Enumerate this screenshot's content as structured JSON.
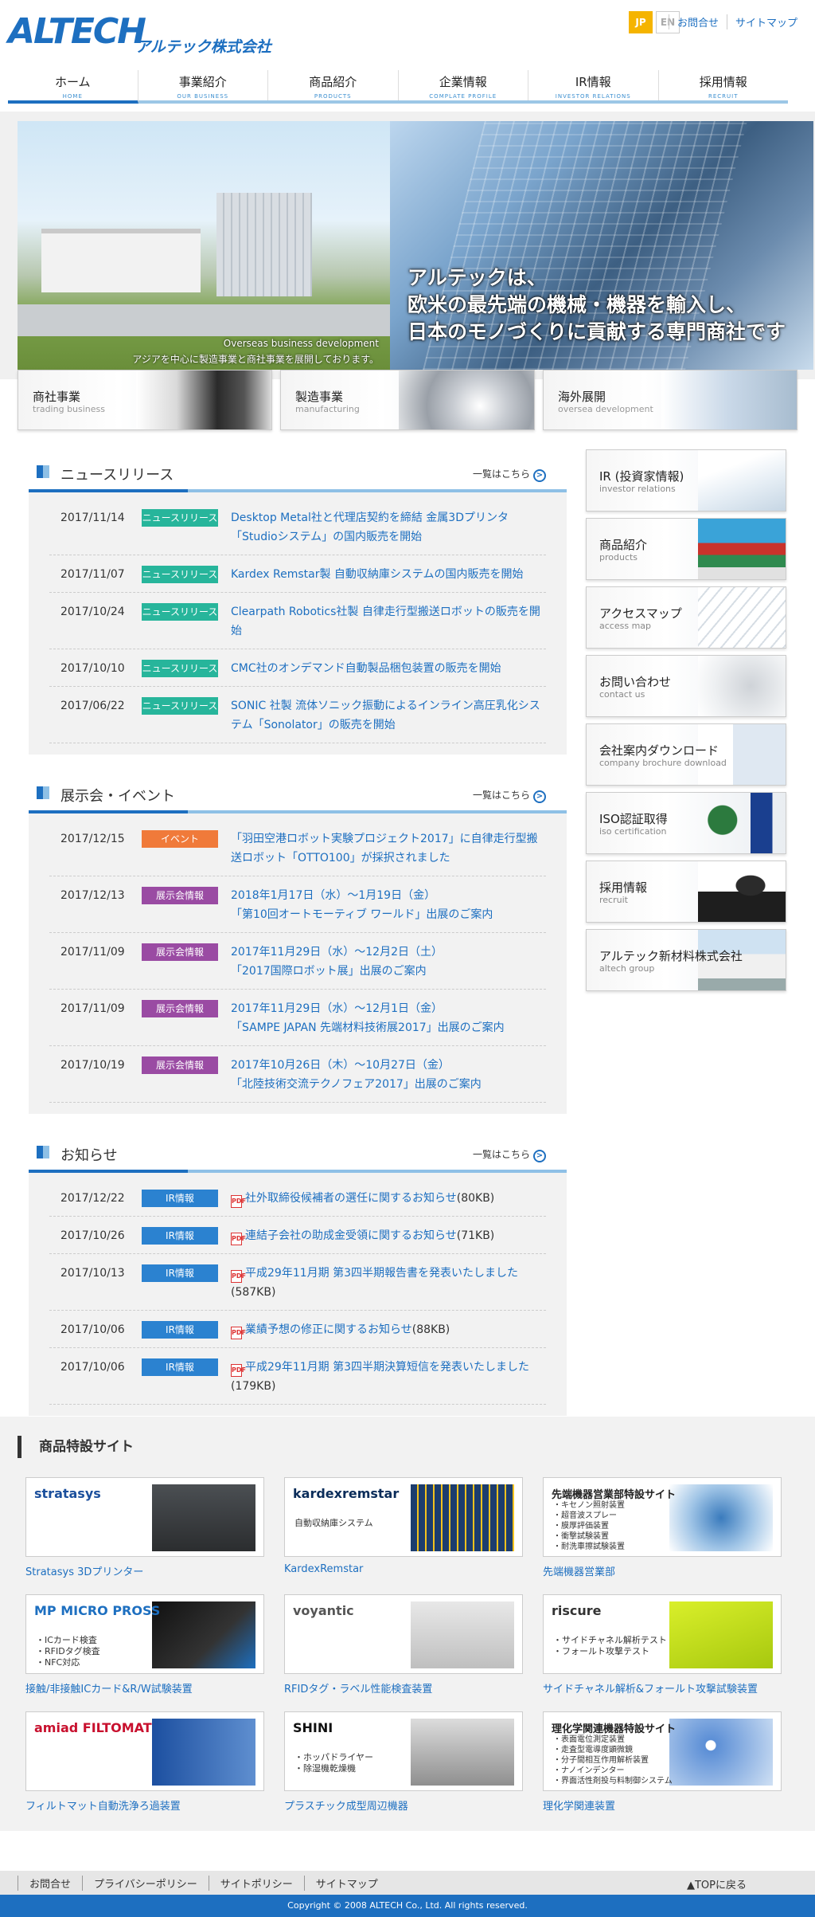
{
  "header": {
    "logo_text": "ALTECH",
    "logo_jp": "アルテック株式会社",
    "lang": [
      "JP",
      "EN"
    ],
    "links": [
      "お問合せ",
      "サイトマップ"
    ],
    "nav": [
      {
        "jp": "ホーム",
        "en": "HOME"
      },
      {
        "jp": "事業紹介",
        "en": "OUR BUSINESS"
      },
      {
        "jp": "商品紹介",
        "en": "PRODUCTS"
      },
      {
        "jp": "企業情報",
        "en": "COMPLATE PROFILE"
      },
      {
        "jp": "IR情報",
        "en": "INVESTOR RELATIONS"
      },
      {
        "jp": "採用情報",
        "en": "RECRUIT"
      }
    ]
  },
  "hero": {
    "caption1": "Overseas business development",
    "caption2": "アジアを中心に製造事業と商社事業を展開しております。",
    "copy": [
      "アルテックは、",
      "欧米の最先端の機械・機器を輸入し、",
      "日本のモノづくりに貢献する専門商社です"
    ]
  },
  "categories": [
    {
      "jp": "商社事業",
      "en": "trading business"
    },
    {
      "jp": "製造事業",
      "en": "manufacturing"
    },
    {
      "jp": "海外展開",
      "en": "oversea development"
    }
  ],
  "news": {
    "title": "ニュースリリース",
    "more": "一覧はこちら",
    "items": [
      {
        "date": "2017/11/14",
        "tag": "ニュースリリース",
        "text": "Desktop Metal社と代理店契約を締結 金属3Dプリンタ「Studioシステム」の国内販売を開始"
      },
      {
        "date": "2017/11/07",
        "tag": "ニュースリリース",
        "text": "Kardex Remstar製 自動収納庫システムの国内販売を開始"
      },
      {
        "date": "2017/10/24",
        "tag": "ニュースリリース",
        "text": "Clearpath Robotics社製 自律走行型搬送ロボットの販売を開始"
      },
      {
        "date": "2017/10/10",
        "tag": "ニュースリリース",
        "text": "CMC社のオンデマンド自動製品梱包装置の販売を開始"
      },
      {
        "date": "2017/06/22",
        "tag": "ニュースリリース",
        "text": "SONIC 社製 流体ソニック振動によるインライン高圧乳化システム「Sonolator」の販売を開始"
      }
    ]
  },
  "events": {
    "title": "展示会・イベント",
    "more": "一覧はこちら",
    "items": [
      {
        "date": "2017/12/15",
        "tag": "イベント",
        "type": "event",
        "text": "「羽田空港ロボット実験プロジェクト2017」に自律走行型搬送ロボット「OTTO100」が採択されました"
      },
      {
        "date": "2017/12/13",
        "tag": "展示会情報",
        "type": "expo",
        "text": "2018年1月17日（水）～1月19日（金）\n「第10回オートモーティブ ワールド」出展のご案内"
      },
      {
        "date": "2017/11/09",
        "tag": "展示会情報",
        "type": "expo",
        "text": "2017年11月29日（水）～12月2日（土）\n「2017国際ロボット展」出展のご案内"
      },
      {
        "date": "2017/11/09",
        "tag": "展示会情報",
        "type": "expo",
        "text": "2017年11月29日（水）～12月1日（金）\n「SAMPE JAPAN 先端材料技術展2017」出展のご案内"
      },
      {
        "date": "2017/10/19",
        "tag": "展示会情報",
        "type": "expo",
        "text": "2017年10月26日（木）～10月27日（金）\n「北陸技術交流テクノフェア2017」出展のご案内"
      }
    ]
  },
  "notices": {
    "title": "お知らせ",
    "more": "一覧はこちら",
    "items": [
      {
        "date": "2017/12/22",
        "tag": "IR情報",
        "text": "社外取締役候補者の選任に関するお知らせ",
        "size": "(80KB)"
      },
      {
        "date": "2017/10/26",
        "tag": "IR情報",
        "text": "連結子会社の助成金受領に関するお知らせ",
        "size": "(71KB)"
      },
      {
        "date": "2017/10/13",
        "tag": "IR情報",
        "text": "平成29年11月期 第3四半期報告書を発表いたしました",
        "size": "(587KB)"
      },
      {
        "date": "2017/10/06",
        "tag": "IR情報",
        "text": "業績予想の修正に関するお知らせ",
        "size": "(88KB)"
      },
      {
        "date": "2017/10/06",
        "tag": "IR情報",
        "text": "平成29年11月期 第3四半期決算短信を発表いたしました",
        "size": "(179KB)"
      }
    ]
  },
  "sidebar": [
    {
      "jp": "IR (投資家情報)",
      "en": "investor relations"
    },
    {
      "jp": "商品紹介",
      "en": "products"
    },
    {
      "jp": "アクセスマップ",
      "en": "access map"
    },
    {
      "jp": "お問い合わせ",
      "en": "contact us"
    },
    {
      "jp": "会社案内ダウンロード",
      "en": "company brochure download"
    },
    {
      "jp": "ISO認証取得",
      "en": "iso certification"
    },
    {
      "jp": "採用情報",
      "en": "recruit"
    },
    {
      "jp": "アルテック新材料株式会社",
      "en": "altech group"
    }
  ],
  "featured": {
    "title": "商品特設サイト",
    "items": [
      {
        "label": "Stratasys 3Dプリンター",
        "brand": "stratasys",
        "brand_color": "#1b4f9c",
        "sub": ""
      },
      {
        "label": "KardexRemstar",
        "brand": "kardexremstar",
        "brand_color": "#0b2d5a",
        "sub": "自動収納庫システム"
      },
      {
        "label": "先端機器営業部",
        "brand": "先端機器営業部特設サイト",
        "brand_color": "#222222",
        "sub": "・キセノン照射装置\n・超音波スプレー\n・膜厚評価装置\n・衝撃試験装置\n・耐洗車擦試験装置"
      },
      {
        "label": "接触/非接触ICカード&R/W試験装置",
        "brand": "MP MICRO PROSS",
        "brand_color": "#1d6fc0",
        "sub": "・ICカード検査\n・RFIDタグ検査\n・NFC対応"
      },
      {
        "label": "RFIDタグ・ラベル性能検査装置",
        "brand": "voyantic",
        "brand_color": "#555555",
        "sub": ""
      },
      {
        "label": "サイドチャネル解析&フォールト攻撃試験装置",
        "brand": "riscure",
        "brand_color": "#333333",
        "sub": "・サイドチャネル解析テスト\n・フォールト攻撃テスト"
      },
      {
        "label": "フィルトマット自動洗浄ろ過装置",
        "brand": "amiad FILTOMAT",
        "brand_color": "#c8102e",
        "sub": ""
      },
      {
        "label": "プラスチック成型周辺機器",
        "brand": "SHINI",
        "brand_color": "#111111",
        "sub": "・ホッパドライヤー\n・除湿機乾燥機"
      },
      {
        "label": "理化学関連装置",
        "brand": "理化学関連機器特設サイト",
        "brand_color": "#222222",
        "sub": "・表面電位測定装置\n・走査型電導度顕微鏡\n・分子間相互作用解析装置\n・ナノインデンター\n・界面活性剤投与料制御システム"
      }
    ]
  },
  "footer": {
    "links": [
      "お問合せ",
      "プライバシーポリシー",
      "サイトポリシー",
      "サイトマップ"
    ],
    "top": "▲TOPに戻る",
    "copyright": "Copyright © 2008 ALTECH Co., Ltd. All rights reserved."
  },
  "colors": {
    "brand": "#1d6fc0",
    "news": "#27b59b",
    "event": "#f07a3a",
    "expo": "#9a4ba3",
    "ir": "#2b82d0"
  }
}
